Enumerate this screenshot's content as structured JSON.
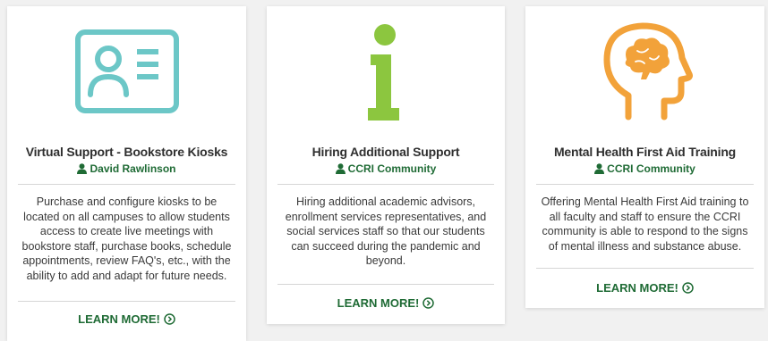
{
  "colors": {
    "page_background": "#f1f1f1",
    "card_background": "#ffffff",
    "title_text": "#2f2f2f",
    "accent_green": "#1f6b35",
    "kiosk_icon_teal": "#6cc7c7",
    "info_icon_lime": "#8cc63f",
    "head_icon_orange": "#f2a23a"
  },
  "cards": [
    {
      "icon": "id-card-icon",
      "title": "Virtual Support - Bookstore Kiosks",
      "author_icon": "user-icon",
      "author": "David Rawlinson",
      "description": "Purchase and configure kiosks to be located on all campuses to allow students access to create live meetings with bookstore staff, purchase books, schedule appointments, review FAQ's, etc., with the ability to add and adapt for future needs.",
      "link_label": "LEARN MORE!",
      "link_icon": "chevron-right-circle-icon"
    },
    {
      "icon": "info-icon",
      "title": "Hiring Additional Support",
      "author_icon": "user-icon",
      "author": "CCRI Community",
      "description": "Hiring additional academic advisors, enrollment services representatives, and social services staff so that our students can succeed during the pandemic and beyond.",
      "link_label": "LEARN MORE!",
      "link_icon": "chevron-right-circle-icon"
    },
    {
      "icon": "brain-head-icon",
      "title": "Mental Health First Aid Training",
      "author_icon": "user-icon",
      "author": "CCRI Community",
      "description": "Offering Mental Health First Aid training to all faculty and staff to ensure the CCRI community is able to respond to the signs of mental illness and substance abuse.",
      "link_label": "LEARN MORE!",
      "link_icon": "chevron-right-circle-icon"
    }
  ]
}
